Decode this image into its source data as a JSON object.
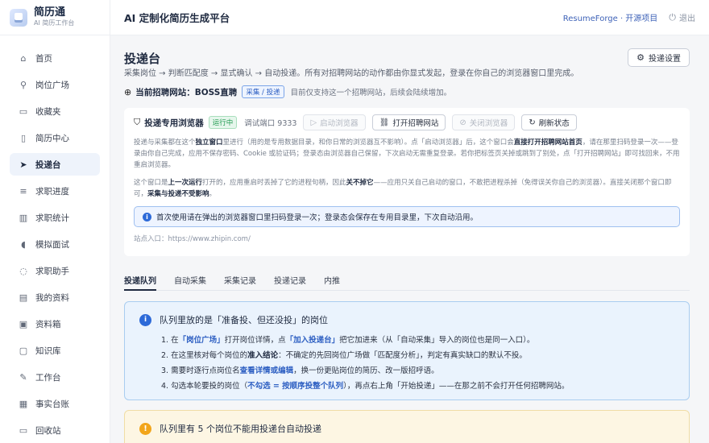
{
  "brand": {
    "name": "简历通",
    "sub": "AI 简历工作台"
  },
  "sidebar": {
    "items": [
      {
        "label": "首页",
        "icon": "home-icon"
      },
      {
        "label": "岗位广场",
        "icon": "search-icon"
      },
      {
        "label": "收藏夹",
        "icon": "folder-icon"
      },
      {
        "label": "简历中心",
        "icon": "document-icon"
      },
      {
        "label": "投递台",
        "icon": "send-icon",
        "active": true
      },
      {
        "label": "求职进度",
        "icon": "sort-icon"
      },
      {
        "label": "求职统计",
        "icon": "bar-chart-icon"
      },
      {
        "label": "模拟面试",
        "icon": "mic-icon"
      },
      {
        "label": "求职助手",
        "icon": "chat-icon"
      },
      {
        "label": "我的资料",
        "icon": "id-card-icon"
      },
      {
        "label": "资料箱",
        "icon": "archive-icon"
      },
      {
        "label": "知识库",
        "icon": "book-icon"
      },
      {
        "label": "工作台",
        "icon": "wrench-icon"
      },
      {
        "label": "事实台账",
        "icon": "ledger-icon"
      },
      {
        "label": "回收站",
        "icon": "trash-icon"
      }
    ]
  },
  "header": {
    "title": "AI 定制化简历生成平台",
    "repo_link": "ResumeForge · 开源项目",
    "logout": "退出"
  },
  "page": {
    "title": "投递台",
    "desc": "采集岗位 → 判断匹配度 → 显式确认 → 自动投递。所有对招聘网站的动作都由你显式发起，登录在你自己的浏览器窗口里完成。",
    "settings_button": "投递设置"
  },
  "site": {
    "label": "当前招聘网站：BOSS直聘",
    "tag": "采集 / 投递",
    "note": "目前仅支持这一个招聘网站，后续会陆续增加。"
  },
  "browser_card": {
    "title": "投递专用浏览器",
    "status": "运行中",
    "port": "调试端口 9333",
    "btn_start": "启动浏览器",
    "btn_open": "打开招聘网站",
    "btn_close": "关闭浏览器",
    "btn_refresh": "刷新状态",
    "p1_a": "投递与采集都在这个",
    "p1_b": "独立窗口",
    "p1_c": "里进行（用的是专用数据目录，和你日常的浏览器互不影响）。点「启动浏览器」后，这个窗口会",
    "p1_d": "直接打开招聘网站首页",
    "p1_e": "，请在那里扫码登录一次——登录由你自己完成，应用不保存密码、Cookie 或验证码；登录态由浏览器自己保留，下次启动无需重复登录。若你把标签页关掉或跳到了别处，点「打开招聘网站」即可找回来，不用重启浏览器。",
    "p2_a": "这个窗口是",
    "p2_b": "上一次运行",
    "p2_c": "打开的，应用重启时丢掉了它的进程句柄，因此",
    "p2_d": "关不掉它",
    "p2_e": "——应用只关自己启动的窗口，不敢把进程杀掉（免得误关你自己的浏览器）。直接关闭那个窗口即可，",
    "p2_f": "采集与投递不受影响",
    "p2_g": "。",
    "info": "首次使用请在弹出的浏览器窗口里扫码登录一次；登录态会保存在专用目录里，下次自动沿用。",
    "entry": "站点入口：https://www.zhipin.com/"
  },
  "tabs": [
    "投递队列",
    "自动采集",
    "采集记录",
    "投递记录",
    "内推"
  ],
  "queue_info": {
    "title": "队列里放的是「准备投、但还没投」的岗位",
    "i1_a": "1. 在",
    "i1_b": "「岗位广场」",
    "i1_c": "打开岗位详情，点",
    "i1_d": "「加入投递台」",
    "i1_e": "把它加进来（从「自动采集」导入的岗位也是同一入口）。",
    "i2_a": "2. 在这里核对每个岗位的",
    "i2_b": "准入结论",
    "i2_c": "：不确定的先回岗位广场做「匹配度分析」，判定有真实缺口的默认不投。",
    "i3_a": "3. 需要时逐行点岗位名",
    "i3_b": "查看详情或编辑",
    "i3_c": "，换一份更贴岗位的简历、改一版招呼语。",
    "i4_a": "4. 勾选本轮要投的岗位（",
    "i4_b": "不勾选 = 按顺序投整个队列",
    "i4_c": "），再点右上角「开始投递」——在那之前不会打开任何招聘网站。"
  },
  "warning": {
    "title": "队列里有 5 个岗位不能用投递台自动投递"
  },
  "colors": {
    "accent": "#2d6ad8",
    "link": "#3f63b8",
    "success": "#1f9a4f",
    "warning": "#f2a51a"
  }
}
